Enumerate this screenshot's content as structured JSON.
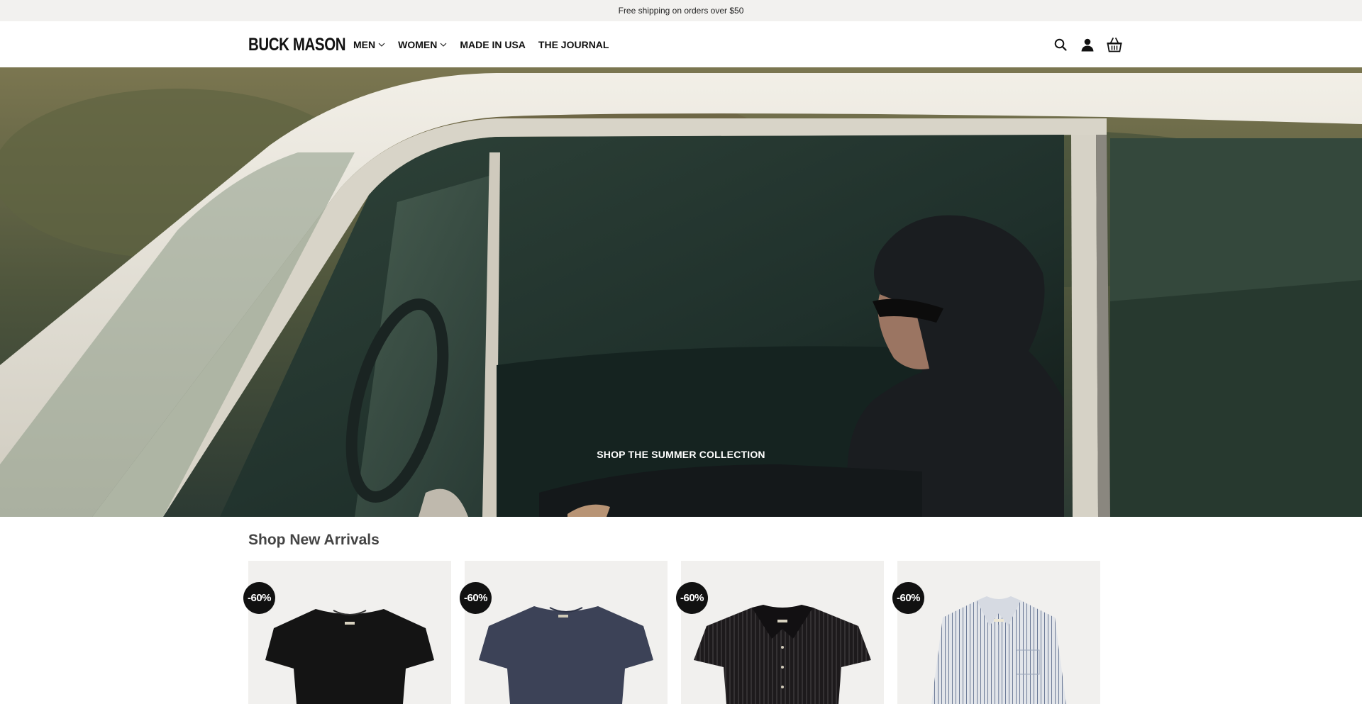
{
  "announcement": {
    "text": "Free shipping on orders over $50"
  },
  "header": {
    "logo": "BUCK MASON",
    "nav": [
      {
        "label": "MEN",
        "has_dropdown": true
      },
      {
        "label": "WOMEN",
        "has_dropdown": true
      },
      {
        "label": "MADE IN USA",
        "has_dropdown": false
      },
      {
        "label": "THE JOURNAL",
        "has_dropdown": false
      }
    ],
    "icons": [
      "search-icon",
      "account-icon",
      "cart-icon"
    ]
  },
  "hero": {
    "cta": "SHOP THE SUMMER COLLECTION"
  },
  "new_arrivals": {
    "title": "Shop New Arrivals",
    "products": [
      {
        "badge": "-60%",
        "image": "black-tee",
        "color": "#141414"
      },
      {
        "badge": "-60%",
        "image": "navy-tee",
        "color": "#3c4257"
      },
      {
        "badge": "-60%",
        "image": "black-pinstripe-camp-shirt",
        "color": "#1d1a1c"
      },
      {
        "badge": "-60%",
        "image": "blue-stripe-oxford-shirt",
        "color": "#c7ccd6"
      }
    ]
  },
  "colors": {
    "announcement_bg": "#f2f1ef",
    "text": "#111111",
    "badge_bg": "#111111",
    "card_bg": "#f1f0ee"
  }
}
